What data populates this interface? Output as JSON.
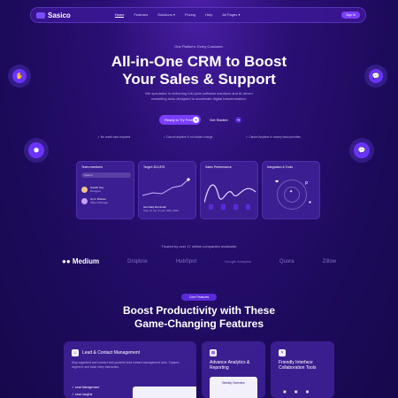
{
  "nav": {
    "brand": "Sasico",
    "links": [
      "Home",
      "Features",
      "Solutions",
      "Pricing",
      "Help",
      "All Pages"
    ],
    "signin": "Sign In"
  },
  "hero": {
    "tagline": "One Platform. Every Customer.",
    "title_line1": "All-in-One CRM to Boost",
    "title_line2": "Your Sales & Support",
    "desc_line1": "We specialize in delivering full-cycle software solutions and AI-driven",
    "desc_line2": "marketing tools designed to accelerate digital transformation.",
    "cta_primary": "Ready to Try Free",
    "cta_secondary": "Get Started",
    "checks": [
      "No credit card required",
      "Cancel anytime & no hidden charge",
      "Cancel Anytime to money back priorities"
    ]
  },
  "dashboard": {
    "team": {
      "title": "Team members",
      "search_placeholder": "Search",
      "members": [
        {
          "name": "Gareth Key",
          "role": "Designer"
        },
        {
          "name": "Ivy F. Briscoe",
          "role": "Sales Manager"
        }
      ]
    },
    "target": {
      "title": "Target: $14,876",
      "footer": "Get Daily Reminder",
      "footer_sub": "Stay on top of your daily tasks"
    },
    "sales": {
      "title": "Sales Performance"
    },
    "integration": {
      "title": "Integration & Tools"
    }
  },
  "trusted": {
    "text": "Trusted by over 17 million companies worldwide",
    "brands": [
      "Medium",
      "Dropbox",
      "HubSpot",
      "Google Analytics",
      "Quora",
      "Zillow"
    ]
  },
  "features": {
    "pill": "Core Features",
    "title_line1": "Boost Productivity with These",
    "title_line2": "Game-Changing Features",
    "cards": [
      {
        "title": "Lead & Contact Management",
        "desc": "Stay organized and connect with powerful lead contact management tools. Capture, segment, and track every interaction.",
        "item": "Lead Management",
        "item2": "Lead Insights"
      },
      {
        "title": "Advance Analytics & Reporting",
        "sub": "Weekly Overview"
      },
      {
        "title": "Friendly Interface Collaboration Tools"
      }
    ]
  },
  "colors": {
    "accent": "#7b3dff",
    "background": "#1c0a5a"
  }
}
